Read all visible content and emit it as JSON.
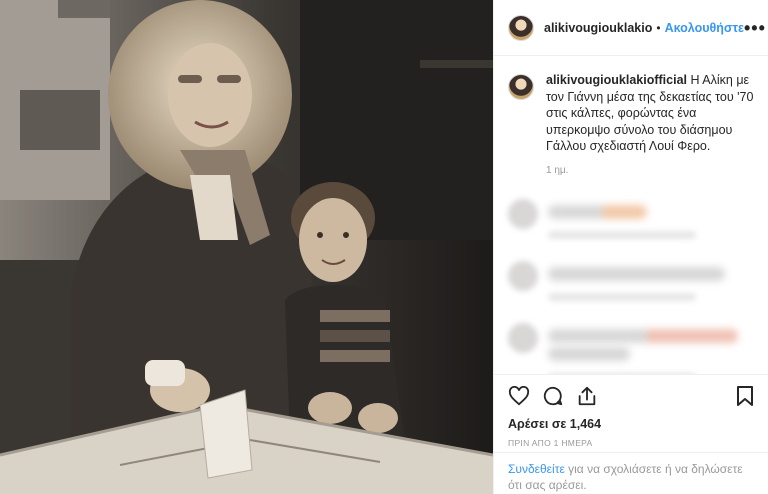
{
  "header": {
    "username": "alikivougiouklakio",
    "separator": "•",
    "follow_label": "Ακολουθήστε",
    "more_label": "•••"
  },
  "caption": {
    "username": "alikivougiouklakiofficial",
    "text": "Η Αλίκη με τον Γιάννη μέσα της δεκαετίας του '70 στις κάλπες, φορώντας ένα υπερκομψο σύνολο του διάσημου Γάλλου σχεδιαστή Λουί Φερο.",
    "time": "1 ημ."
  },
  "actions": {
    "icons": [
      "heart-icon",
      "comment-icon",
      "share-icon",
      "bookmark-icon"
    ]
  },
  "likes_text": "Αρέσει σε 1,464",
  "timestamp": "ΠΡΙΝ ΑΠΟ 1 ΗΜΕΡΑ",
  "login": {
    "link": "Συνδεθείτε",
    "text": " για να σχολιάσετε ή να δηλώσετε ότι σας αρέσει."
  },
  "colors": {
    "link": "#3897f0",
    "muted": "#999999",
    "border": "#efefef"
  }
}
